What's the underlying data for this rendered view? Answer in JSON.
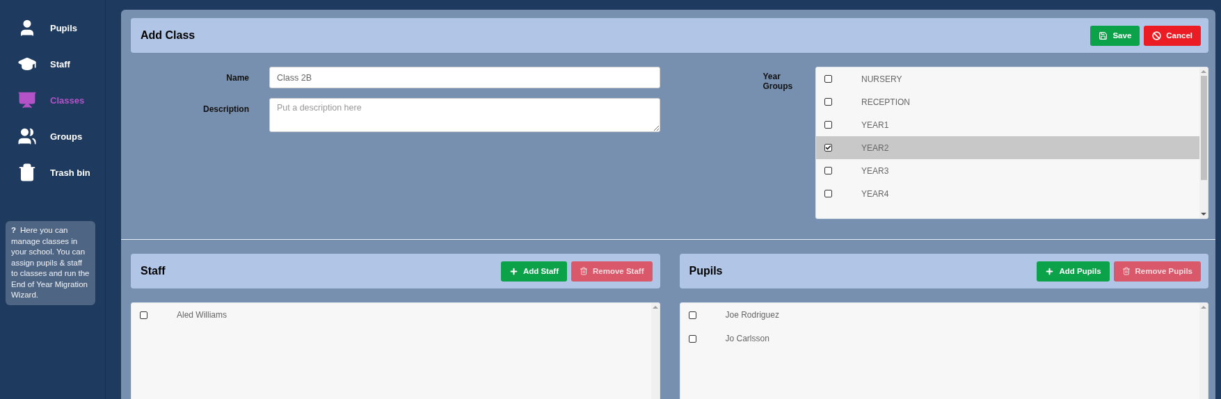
{
  "sidebar": {
    "items": [
      {
        "label": "Pupils",
        "kind": "pupil",
        "selected": false
      },
      {
        "label": "Staff",
        "kind": "staff",
        "selected": false
      },
      {
        "label": "Classes",
        "kind": "class",
        "selected": true
      },
      {
        "label": "Groups",
        "kind": "group",
        "selected": false
      },
      {
        "label": "Trash bin",
        "kind": "trash",
        "selected": false
      }
    ],
    "help": {
      "mark": "?",
      "text": "Here you can manage classes in your school. You can assign pupils & staff to classes and run the End of Year Migration Wizard."
    }
  },
  "form": {
    "title": "Add Class",
    "buttons": [
      {
        "label": "Save",
        "kind": "save"
      },
      {
        "label": "Cancel",
        "kind": "cancel"
      }
    ],
    "name": {
      "label": "Name",
      "value": "Class 2B"
    },
    "description": {
      "label": "Description",
      "placeholder": "Put a description here"
    },
    "year_groups": {
      "label": "Year Groups",
      "items": [
        {
          "label": "NURSERY",
          "checked": false,
          "selected": false
        },
        {
          "label": "RECEPTION",
          "checked": false,
          "selected": false
        },
        {
          "label": "YEAR1",
          "checked": false,
          "selected": false
        },
        {
          "label": "YEAR2",
          "checked": true,
          "selected": true
        },
        {
          "label": "YEAR3",
          "checked": false,
          "selected": false
        },
        {
          "label": "YEAR4",
          "checked": false,
          "selected": false
        }
      ]
    }
  },
  "panels": [
    {
      "title": "Staff",
      "buttons": [
        {
          "label": "Add Staff",
          "kind": "add"
        },
        {
          "label": "Remove Staff",
          "kind": "remove"
        }
      ],
      "items": [
        {
          "label": "Aled Williams",
          "checked": false
        }
      ]
    },
    {
      "title": "Pupils",
      "buttons": [
        {
          "label": "Add Pupils",
          "kind": "add"
        },
        {
          "label": "Remove Pupils",
          "kind": "remove"
        }
      ],
      "items": [
        {
          "label": "Joe Rodriguez",
          "checked": false
        },
        {
          "label": "Jo Carlsson",
          "checked": false
        }
      ]
    }
  ]
}
